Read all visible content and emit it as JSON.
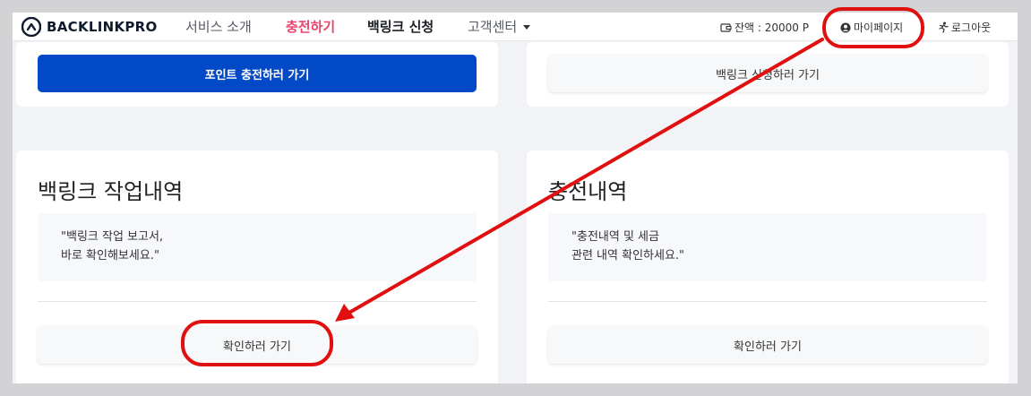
{
  "brand": {
    "name": "BACKLINKPRO",
    "color": "#0f1b2d"
  },
  "nav": {
    "items": [
      {
        "label": "서비스 소개",
        "state": "normal"
      },
      {
        "label": "충전하기",
        "state": "active"
      },
      {
        "label": "백링크 신청",
        "state": "bold"
      },
      {
        "label": "고객센터",
        "state": "dropdown"
      }
    ],
    "balance": "잔액 : 20000 P",
    "mypage": "마이페이지",
    "logout": "로그아웃"
  },
  "cards": {
    "charge_top": {
      "button": "포인트 충전하러 가기"
    },
    "backlink_top": {
      "button": "백링크 신청하러 가기"
    },
    "backlink_history": {
      "title": "백링크 작업내역",
      "quote_line1": "\"백링크 작업 보고서,",
      "quote_line2": "바로 확인해보세요.\"",
      "button": "확인하러 가기"
    },
    "charge_history": {
      "title": "충전내역",
      "quote_line1": "\"충전내역 및 세금",
      "quote_line2": "관련 내역 확인하세요.\"",
      "button": "확인하러 가기"
    }
  },
  "colors": {
    "primary": "#0249c7",
    "active_nav": "#e8446a",
    "annotation": "#e01010"
  },
  "icons": {
    "logo": "backlinkpro-logo-icon",
    "balance": "wallet-icon",
    "mypage": "user-circle-icon",
    "logout": "running-person-icon",
    "dropdown": "caret-down-icon"
  }
}
